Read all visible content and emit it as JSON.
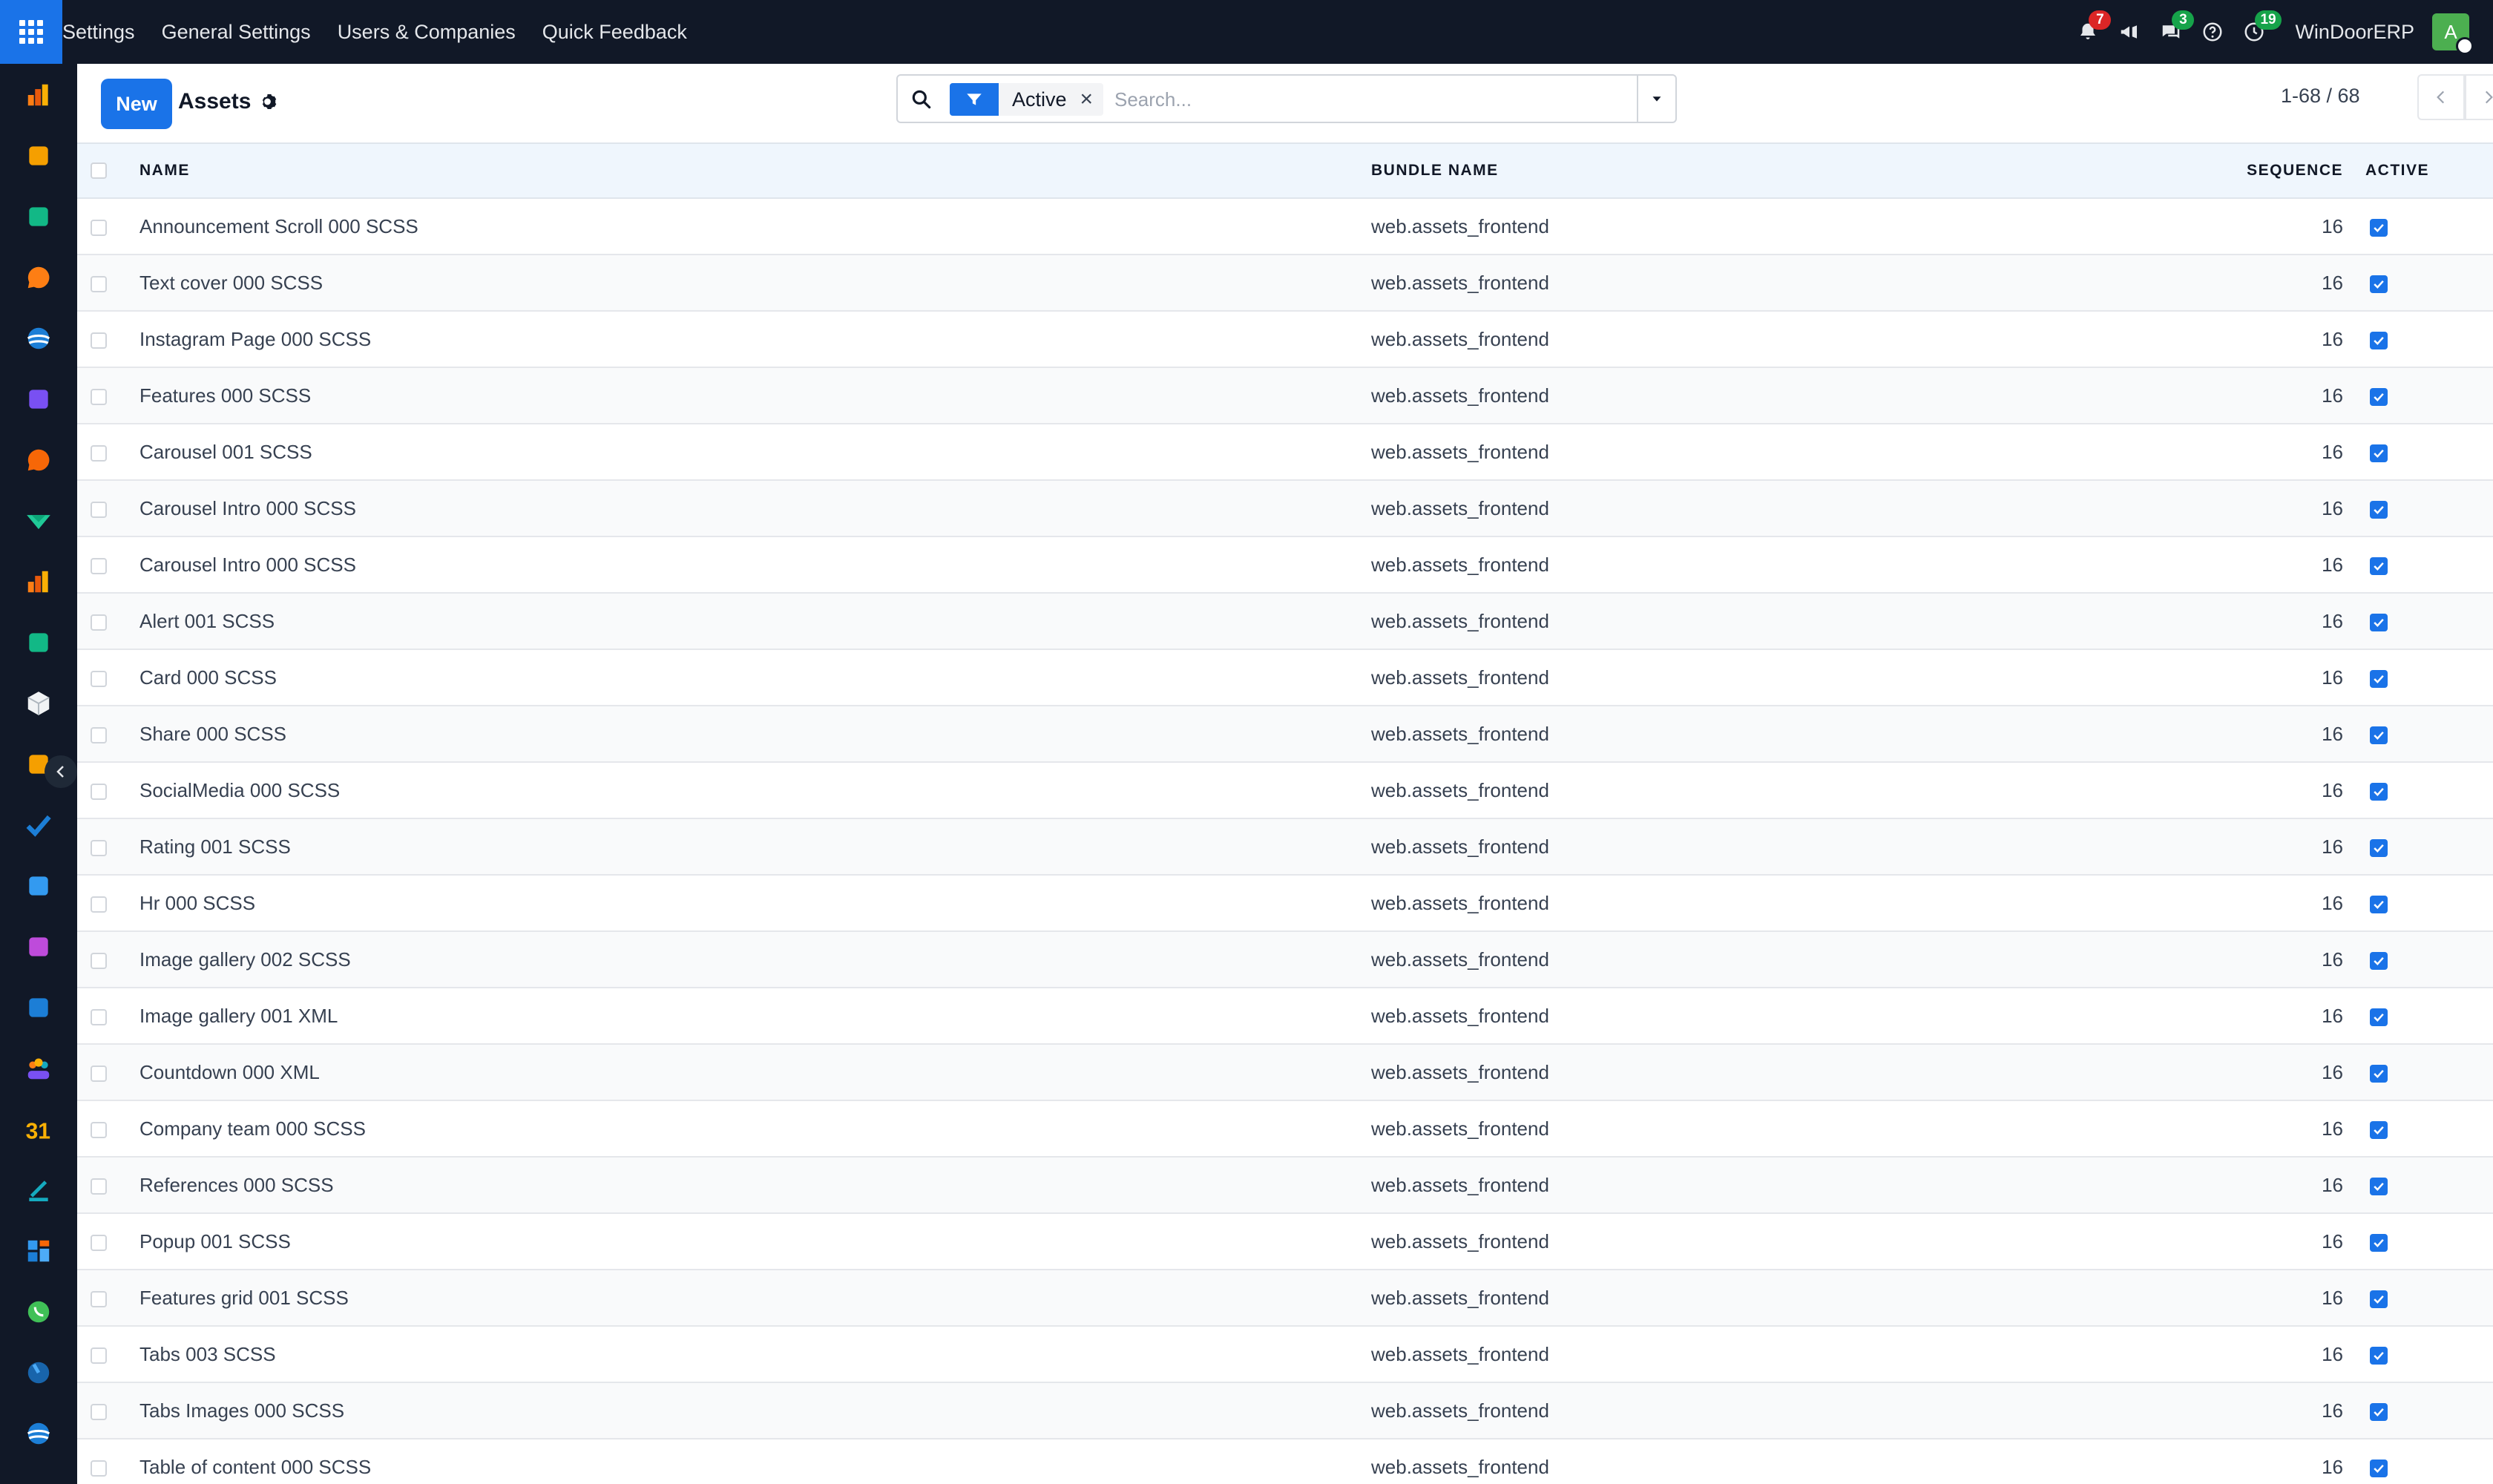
{
  "topbar": {
    "menu": [
      "Settings",
      "General Settings",
      "Users & Companies",
      "Quick Feedback"
    ],
    "badges": {
      "activity": "7",
      "messages": "3",
      "clock": "19"
    },
    "company": "WinDoorERP",
    "avatar_letter": "A"
  },
  "control": {
    "new_label": "New",
    "title": "Assets",
    "facet_label": "Active",
    "facet_remove": "×",
    "search_placeholder": "Search...",
    "pager_value": "1-68 / 68"
  },
  "table": {
    "headers": {
      "name": "Name",
      "bundle": "Bundle Name",
      "sequence": "Sequence",
      "active": "Active"
    },
    "rows": [
      {
        "name": "Announcement Scroll 000 SCSS",
        "bundle": "web.assets_frontend",
        "sequence": "16"
      },
      {
        "name": "Text cover 000 SCSS",
        "bundle": "web.assets_frontend",
        "sequence": "16"
      },
      {
        "name": "Instagram Page 000 SCSS",
        "bundle": "web.assets_frontend",
        "sequence": "16"
      },
      {
        "name": "Features 000 SCSS",
        "bundle": "web.assets_frontend",
        "sequence": "16"
      },
      {
        "name": "Carousel 001 SCSS",
        "bundle": "web.assets_frontend",
        "sequence": "16"
      },
      {
        "name": "Carousel Intro 000 SCSS",
        "bundle": "web.assets_frontend",
        "sequence": "16"
      },
      {
        "name": "Carousel Intro 000 SCSS",
        "bundle": "web.assets_frontend",
        "sequence": "16"
      },
      {
        "name": "Alert 001 SCSS",
        "bundle": "web.assets_frontend",
        "sequence": "16"
      },
      {
        "name": "Card 000 SCSS",
        "bundle": "web.assets_frontend",
        "sequence": "16"
      },
      {
        "name": "Share 000 SCSS",
        "bundle": "web.assets_frontend",
        "sequence": "16"
      },
      {
        "name": "SocialMedia 000 SCSS",
        "bundle": "web.assets_frontend",
        "sequence": "16"
      },
      {
        "name": "Rating 001 SCSS",
        "bundle": "web.assets_frontend",
        "sequence": "16"
      },
      {
        "name": "Hr 000 SCSS",
        "bundle": "web.assets_frontend",
        "sequence": "16"
      },
      {
        "name": "Image gallery 002 SCSS",
        "bundle": "web.assets_frontend",
        "sequence": "16"
      },
      {
        "name": "Image gallery 001 XML",
        "bundle": "web.assets_frontend",
        "sequence": "16"
      },
      {
        "name": "Countdown 000 XML",
        "bundle": "web.assets_frontend",
        "sequence": "16"
      },
      {
        "name": "Company team 000 SCSS",
        "bundle": "web.assets_frontend",
        "sequence": "16"
      },
      {
        "name": "References 000 SCSS",
        "bundle": "web.assets_frontend",
        "sequence": "16"
      },
      {
        "name": "Popup 001 SCSS",
        "bundle": "web.assets_frontend",
        "sequence": "16"
      },
      {
        "name": "Features grid 001 SCSS",
        "bundle": "web.assets_frontend",
        "sequence": "16"
      },
      {
        "name": "Tabs 003 SCSS",
        "bundle": "web.assets_frontend",
        "sequence": "16"
      },
      {
        "name": "Tabs Images 000 SCSS",
        "bundle": "web.assets_frontend",
        "sequence": "16"
      },
      {
        "name": "Table of content 000 SCSS",
        "bundle": "web.assets_frontend",
        "sequence": "16"
      }
    ]
  },
  "rail": {
    "apps": [
      {
        "icon": "dashboard-chart-icon",
        "color": "#e8590c"
      },
      {
        "icon": "planning-icon",
        "color": "#f59f00"
      },
      {
        "icon": "contacts-icon",
        "color": "#12b886"
      },
      {
        "icon": "discuss-icon",
        "color": "#fd7e14"
      },
      {
        "icon": "website-icon",
        "color": "#1c7ed6"
      },
      {
        "icon": "email-marketing-icon",
        "color": "#7950f2"
      },
      {
        "icon": "livechat-icon",
        "color": "#f76707"
      },
      {
        "icon": "project-icon",
        "color": "#20c997"
      },
      {
        "icon": "reporting-icon",
        "color": "#e8590c"
      },
      {
        "icon": "employees-icon",
        "color": "#12b886"
      },
      {
        "icon": "inventory-icon",
        "color": "#f1f3f5"
      },
      {
        "icon": "sign-icon",
        "color": "#f59f00"
      },
      {
        "icon": "todo-icon",
        "color": "#1c7ed6"
      },
      {
        "icon": "knowledge-icon",
        "color": "#339af0"
      },
      {
        "icon": "apps-box-icon",
        "color": "#be4bdb"
      },
      {
        "icon": "invoicing-icon",
        "color": "#1c7ed6"
      },
      {
        "icon": "members-icon",
        "color": "#fab005"
      },
      {
        "icon": "calendar-icon",
        "color": "#fab005"
      },
      {
        "icon": "signature-icon",
        "color": "#15aabf"
      },
      {
        "icon": "dashboards-icon",
        "color": "#339af0"
      },
      {
        "icon": "whatsapp-icon",
        "color": "#40c057"
      },
      {
        "icon": "time-off-icon",
        "color": "#4dabf7"
      },
      {
        "icon": "website-icon",
        "color": "#1c7ed6"
      }
    ]
  }
}
